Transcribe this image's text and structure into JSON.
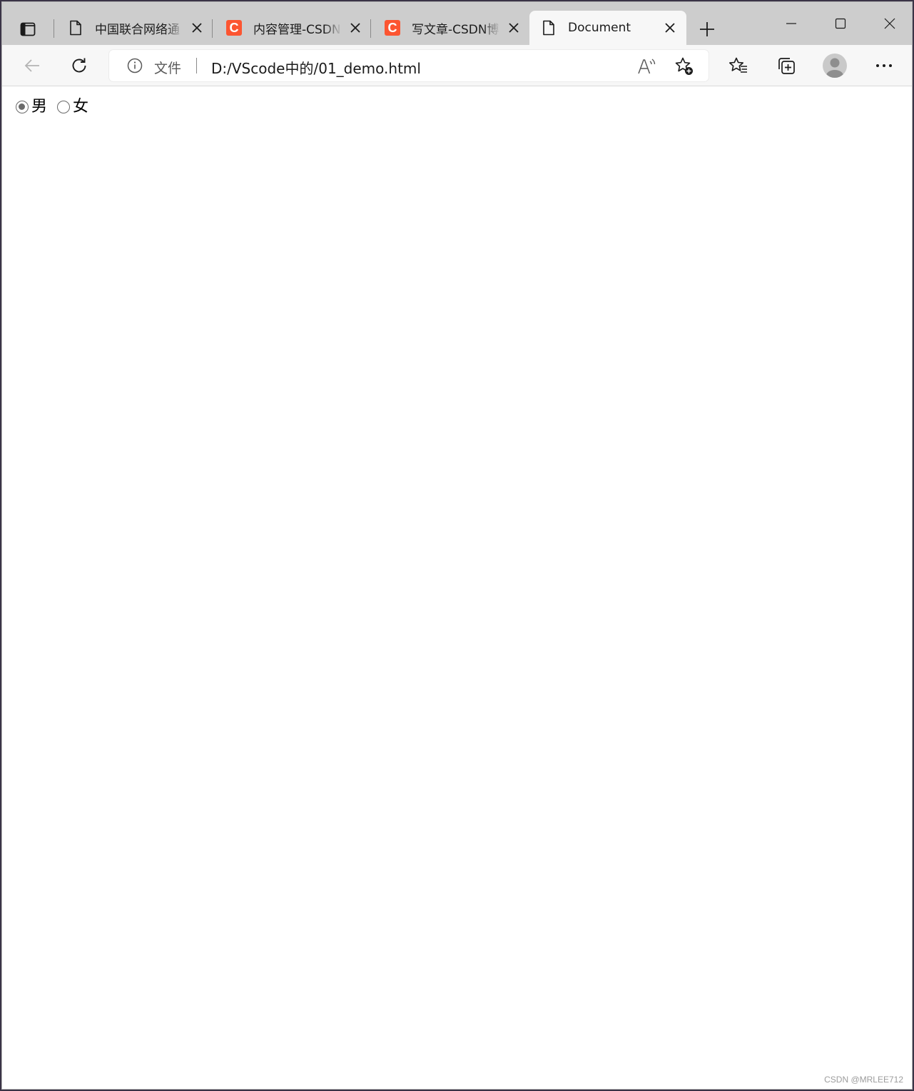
{
  "browser": {
    "tabs": [
      {
        "title": "中国联合网络通",
        "favicon": "document-icon"
      },
      {
        "title": "内容管理-CSDN",
        "favicon": "csdn-logo"
      },
      {
        "title": "写文章-CSDN博",
        "favicon": "csdn-logo"
      },
      {
        "title": "Document",
        "favicon": "document-icon",
        "active": true
      }
    ],
    "csdn_logo_letter": "C",
    "csdn_color": "#fc5531"
  },
  "address": {
    "label": "文件",
    "url": "D:/VScode中的/01_demo.html"
  },
  "page": {
    "radio_male": "男",
    "radio_female": "女",
    "selected": "男"
  },
  "watermark": "CSDN @MRLEE712"
}
